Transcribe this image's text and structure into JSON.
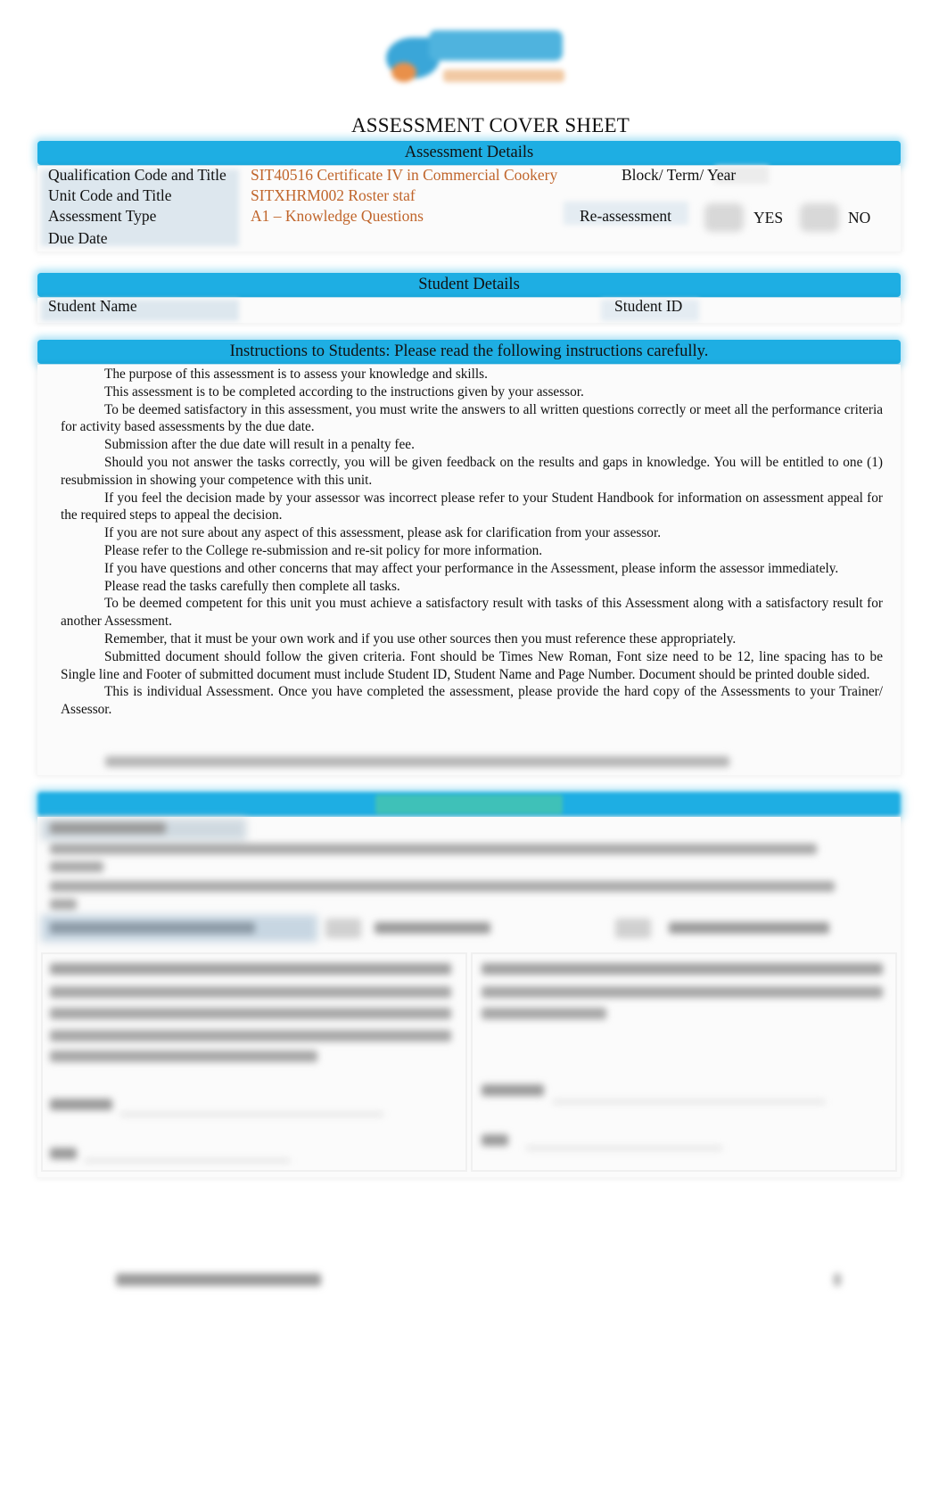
{
  "logo": {
    "name": "Skyline",
    "icon": "skyline-logo-icon"
  },
  "title": "ASSESSMENT COVER SHEET",
  "assessment_details": {
    "heading": "Assessment Details",
    "qualification_label": "Qualification Code and Title",
    "qualification_value": "SIT40516 Certificate IV in Commercial Cookery",
    "block_label": "Block/ Term/ Year",
    "block_value": "",
    "unit_label": "Unit Code and Title",
    "unit_value": "SITXHRM002 Roster staf",
    "type_label": "Assessment Type",
    "type_value": "A1 – Knowledge Questions",
    "reassessment_label": "Re-assessment",
    "yes_label": "YES",
    "no_label": "NO",
    "due_date_label": "Due Date",
    "due_date_value": ""
  },
  "student_details": {
    "heading": "Student Details",
    "name_label": "Student Name",
    "name_value": "",
    "id_label": "Student ID",
    "id_value": ""
  },
  "instructions": {
    "heading": "Instructions to Students:   Please read the following instructions carefully.",
    "bullet_glyph": "",
    "items": [
      "The purpose of this assessment is to assess your knowledge and skills.",
      "This assessment is to be completed according to the instructions given by your assessor.",
      "To be deemed satisfactory in this assessment, you must write the answers to all written questions correctly or meet all the performance criteria for activity based assessments by the due date.",
      "Submission after the due date will result in a penalty fee.",
      "Should you not answer the tasks correctly, you will be given feedback on the results and gaps in knowledge. You will be entitled to one (1) resubmission in showing your competence with this unit.",
      "If you feel the decision made by your assessor was incorrect please refer to your Student Handbook for information on assessment appeal for the required steps to appeal the decision.",
      "If you are not sure about any aspect of this assessment, please ask for clarification from your assessor.",
      "Please refer to the College re-submission and re-sit policy for more information.",
      "If you have questions and other concerns that may affect your performance in the Assessment, please inform the assessor immediately.",
      "Please read the tasks carefully then complete all tasks.",
      "To be deemed competent for this unit you must achieve a satisfactory result with tasks of this Assessment along with a satisfactory result for another Assessment.",
      "Remember, that it must be your own work and if you use other sources then you must reference these appropriately.",
      "Submitted document should follow the given criteria. Font should be Times New Roman, Font size need to be 12, line spacing has to be Single line and Footer of submitted document must include Student ID, Student Name and Page Number. Document should be printed double sided.",
      "This is individual Assessment. Once you have completed the assessment, please provide the hard copy of the Assessments to your Trainer/ Assessor."
    ]
  },
  "blurred_notice": "[blurred text]",
  "results_section": {
    "heading": "[blurred heading]",
    "note": "[blurred text]",
    "outcome_label": "[blurred]",
    "option_1": "[blurred]",
    "option_2": "[blurred]",
    "left_box_signature": "[blurred]",
    "left_box_date": "[blurred]",
    "right_box_signature": "[blurred]",
    "right_box_date": "[blurred]"
  },
  "footer": {
    "left": "[blurred footer]",
    "page": "[blurred]"
  },
  "colors": {
    "band": "#1eaee3",
    "value_text": "#c0652b",
    "label_cell": "#dde7ee"
  }
}
